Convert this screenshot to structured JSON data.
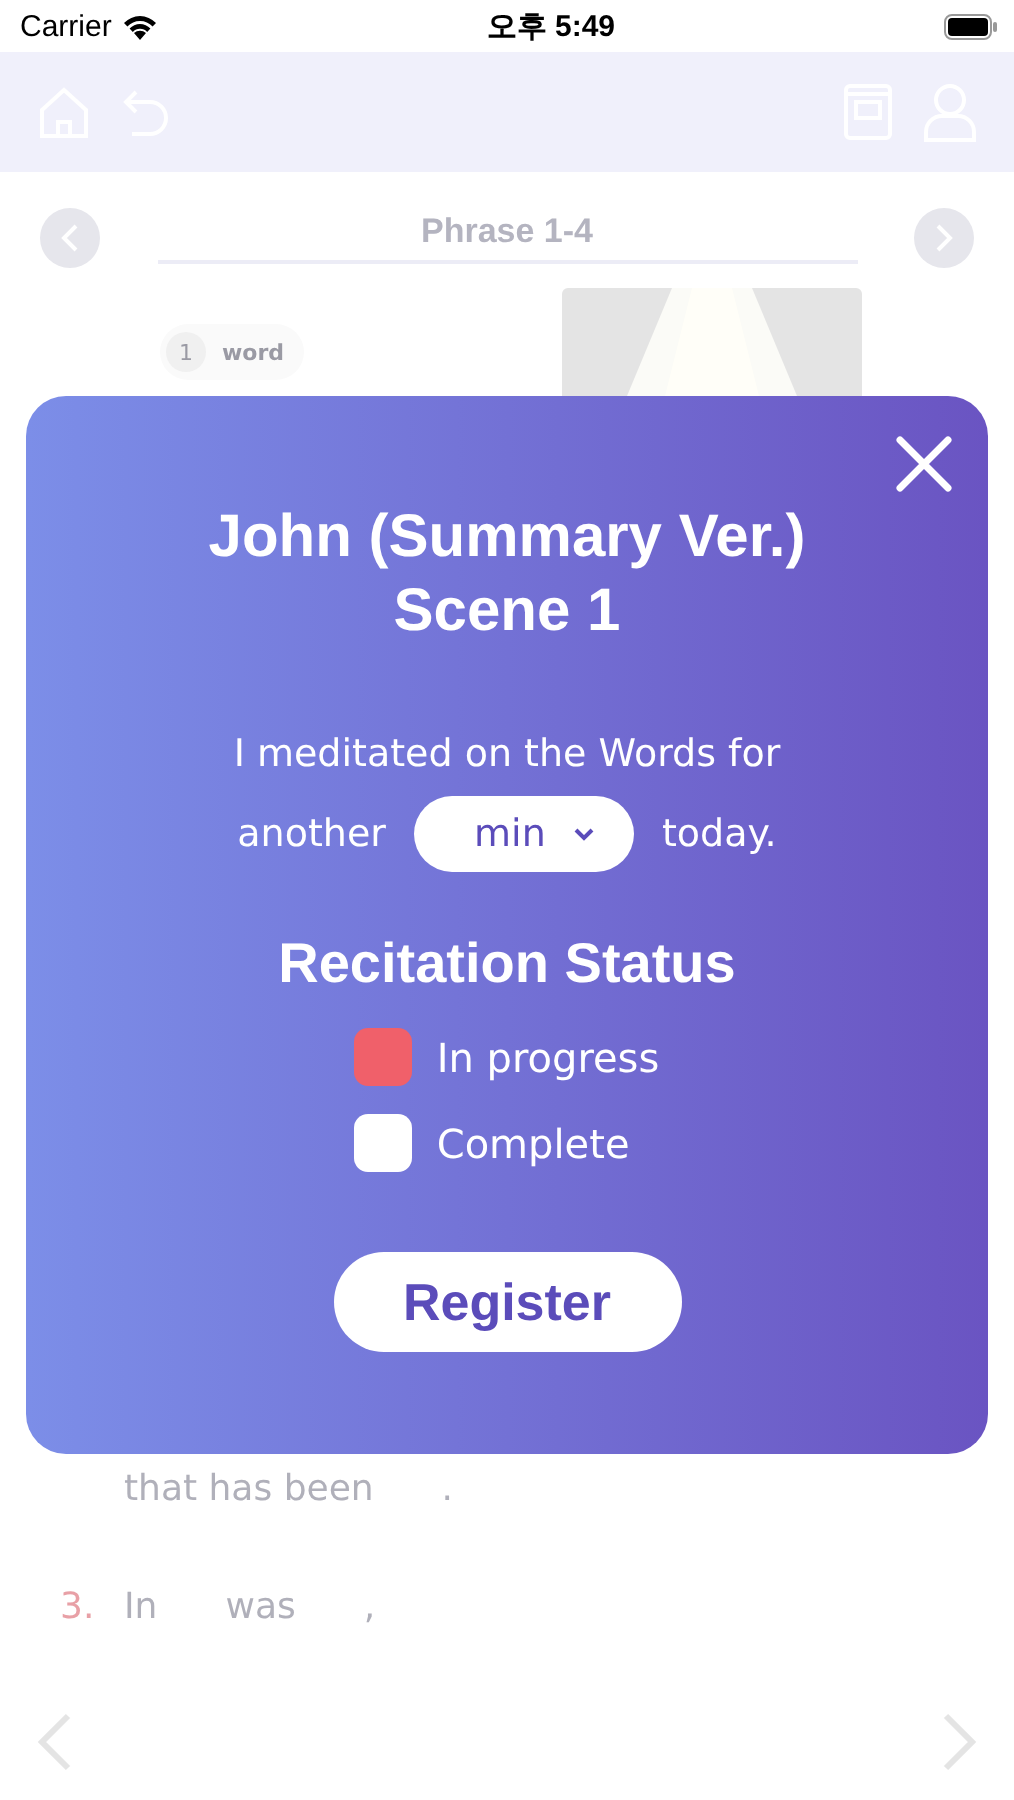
{
  "status_bar": {
    "carrier": "Carrier",
    "time": "오후 5:49"
  },
  "lesson": {
    "title": "Phrase 1-4",
    "word_chip": {
      "number": "1",
      "label": "word"
    },
    "verses": [
      {
        "words": [
          "that has been",
          "."
        ]
      },
      {
        "number": "3.",
        "words": [
          "In",
          "was",
          ","
        ]
      }
    ]
  },
  "dialog": {
    "title_lines": [
      "John (Summary Ver.)",
      "Scene 1"
    ],
    "intro_line": "I meditated on the Words for",
    "before_select": "another",
    "select": {
      "value": "min"
    },
    "after_select": "today.",
    "status_heading": "Recitation Status",
    "options": [
      {
        "label": "In progress",
        "selected": true
      },
      {
        "label": "Complete",
        "selected": false
      }
    ],
    "button": "Register"
  }
}
